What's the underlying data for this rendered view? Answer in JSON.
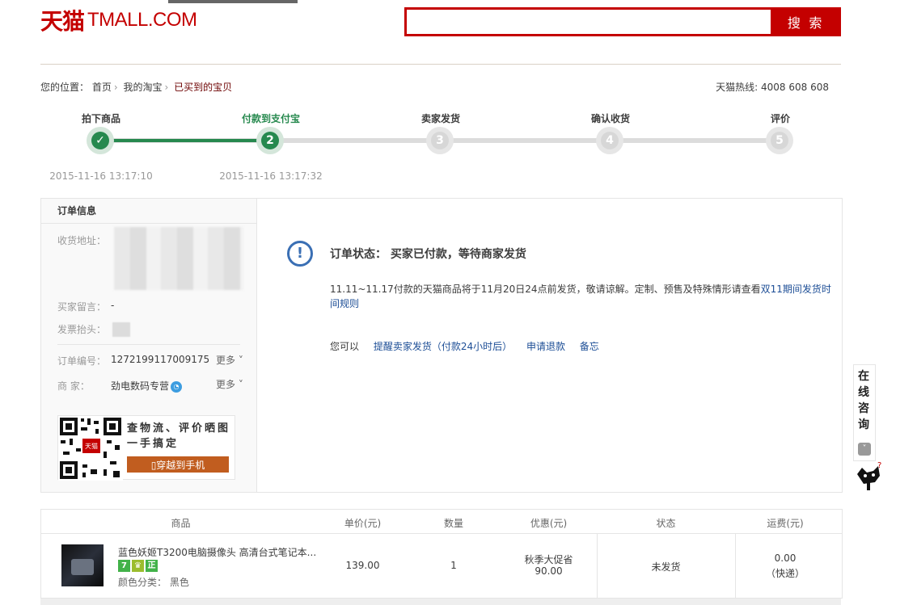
{
  "header": {
    "logo_cn": "天猫",
    "logo_en": "TMALL.COM",
    "search_placeholder": "",
    "search_button": "搜 索"
  },
  "breadcrumb": {
    "prefix": "您的位置：",
    "items": [
      "首页",
      "我的淘宝",
      "已买到的宝贝"
    ],
    "hotline": "天猫热线: 4008 608 608"
  },
  "progress": {
    "steps": [
      {
        "label": "拍下商品",
        "number": "✓",
        "time": "2015-11-16 13:17:10"
      },
      {
        "label": "付款到支付宝",
        "number": "2",
        "time": "2015-11-16 13:17:32"
      },
      {
        "label": "卖家发货",
        "number": "3",
        "time": ""
      },
      {
        "label": "确认收货",
        "number": "4",
        "time": ""
      },
      {
        "label": "评价",
        "number": "5",
        "time": ""
      }
    ],
    "completed_steps": 2
  },
  "order_info": {
    "title": "订单信息",
    "address_label": "收货地址：",
    "message_label": "买家留言：",
    "message_value": "-",
    "invoice_label": "发票抬头：",
    "invoice_value": ".",
    "order_no_label": "订单编号：",
    "order_no": "1272199117009175",
    "more": "更多",
    "seller_label": "商    家：",
    "seller": "劲电数码专营",
    "qr_text_1": "查物流、评价晒图",
    "qr_text_2": "一手搞定",
    "qr_button": "穿越到手机",
    "qr_badge": "天猫"
  },
  "status": {
    "icon": "!",
    "text": "订单状态： 买家已付款，等待商家发货",
    "notice_text": "11.11~11.17付款的天猫商品将于11月20日24点前发货，敬请谅解。定制、预售及特殊情形请查看",
    "notice_link": "双11期间发货时间规则",
    "actions_prefix": "您可以",
    "actions": [
      "提醒卖家发货（付款24小时后）",
      "申请退款",
      "备忘"
    ]
  },
  "consult": {
    "text": "在线咨询"
  },
  "table": {
    "headers": [
      "商品",
      "单价(元)",
      "数量",
      "优惠(元)",
      "状态",
      "运费(元)"
    ],
    "row": {
      "title": "蓝色妖姬T3200电脑摄像头 高清台式笔记本...",
      "badges": [
        "7",
        "♛",
        "正"
      ],
      "attr": "颜色分类： 黑色",
      "price": "139.00",
      "qty": "1",
      "discount_name": "秋季大促省",
      "discount": "90.00",
      "status": "未发货",
      "shipping": "0.00",
      "shipping_type": "（快递）"
    }
  },
  "colors": {
    "brand": "#c40000",
    "progress": "#26894e",
    "link": "#1d4e96"
  }
}
